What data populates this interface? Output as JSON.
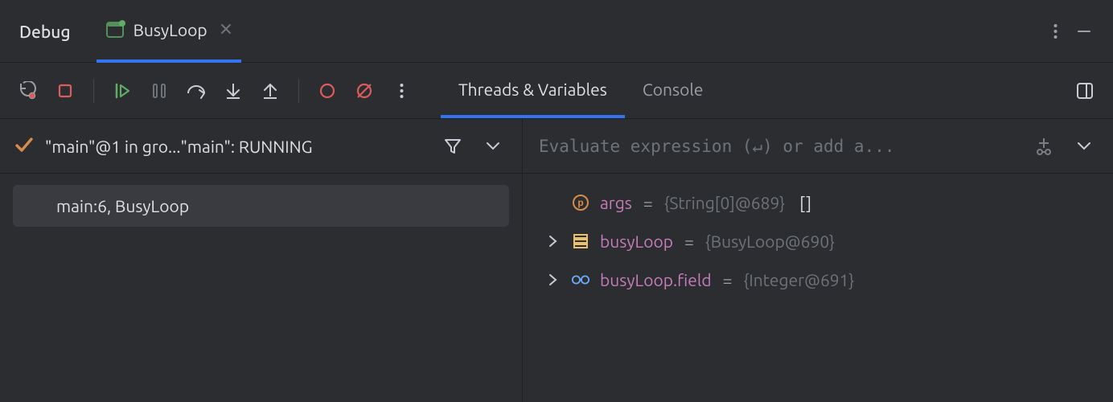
{
  "header": {
    "title": "Debug",
    "tab_label": "BusyLoop"
  },
  "sub_tabs": {
    "threads": "Threads & Variables",
    "console": "Console"
  },
  "thread": {
    "label": "\"main\"@1 in gro...\"main\": RUNNING"
  },
  "frames": [
    {
      "label": "main:6, BusyLoop"
    }
  ],
  "evaluate": {
    "placeholder": "Evaluate expression (↵) or add a..."
  },
  "variables": [
    {
      "expandable": false,
      "icon": "param",
      "name": "args",
      "value": "{String[0]@689}",
      "extra": "[]"
    },
    {
      "expandable": true,
      "icon": "object",
      "name": "busyLoop",
      "value": "{BusyLoop@690}",
      "extra": ""
    },
    {
      "expandable": true,
      "icon": "watch",
      "name": "busyLoop.field",
      "value": "{Integer@691}",
      "extra": ""
    }
  ]
}
